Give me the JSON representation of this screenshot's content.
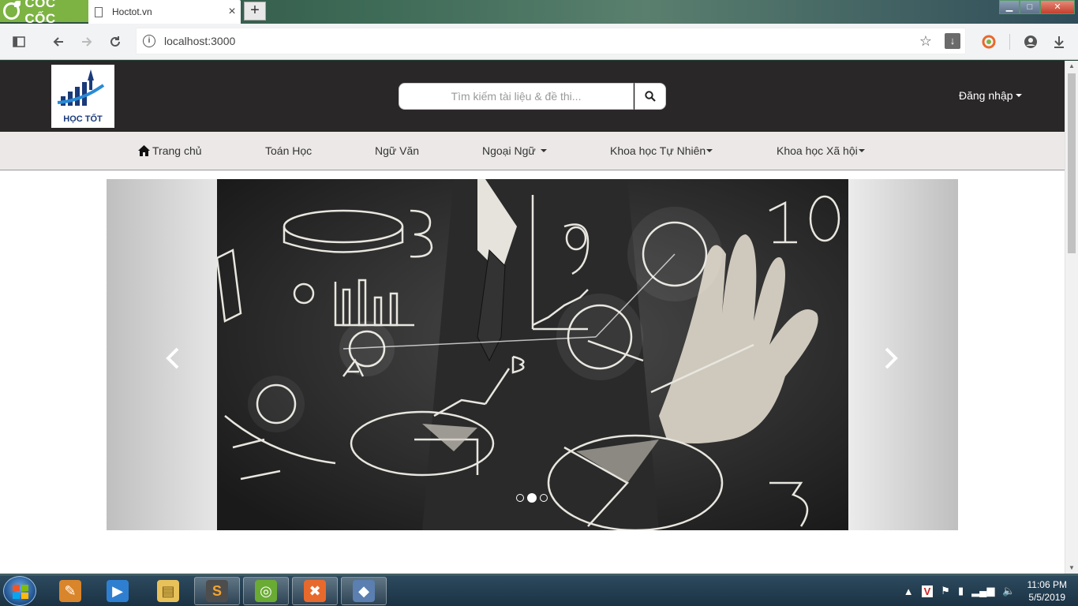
{
  "browser": {
    "brand": "CỐC CỐC",
    "tab_title": "Hoctot.vn",
    "tab_close": "×",
    "new_tab": "+",
    "url": "localhost:3000",
    "window_controls": {
      "minimize": "▁",
      "maximize": "□",
      "close": "✕"
    }
  },
  "site": {
    "logo_text": "HỌC TỐT",
    "search_placeholder": "Tìm kiếm tài liệu & đề thi...",
    "login_label": "Đăng nhập",
    "nav": [
      {
        "label": "Trang chủ"
      },
      {
        "label": "Toán Học"
      },
      {
        "label": "Ngữ Văn"
      },
      {
        "label": "Ngoại Ngữ"
      },
      {
        "label": "Khoa học Tự Nhiên"
      },
      {
        "label": "Khoa học Xã hội"
      }
    ],
    "carousel": {
      "prev": "‹",
      "next": "›",
      "slide_count": 3,
      "active_index": 1
    }
  },
  "taskbar": {
    "time": "11:06 PM",
    "date": "5/5/2019",
    "apps": [
      {
        "name": "paint",
        "symbol": "✎",
        "color": "#d9852b"
      },
      {
        "name": "media-player",
        "symbol": "▶",
        "color": "#2f7fd1"
      },
      {
        "name": "file-explorer",
        "symbol": "▤",
        "color": "#e8c15a"
      },
      {
        "name": "sublime-text",
        "symbol": "S",
        "color": "#4d4d4d"
      },
      {
        "name": "coccoc-browser",
        "symbol": "◎",
        "color": "#6aab34"
      },
      {
        "name": "xampp",
        "symbol": "✖",
        "color": "#e8692c"
      },
      {
        "name": "git-gui",
        "symbol": "◆",
        "color": "#5a7fb0"
      }
    ]
  }
}
